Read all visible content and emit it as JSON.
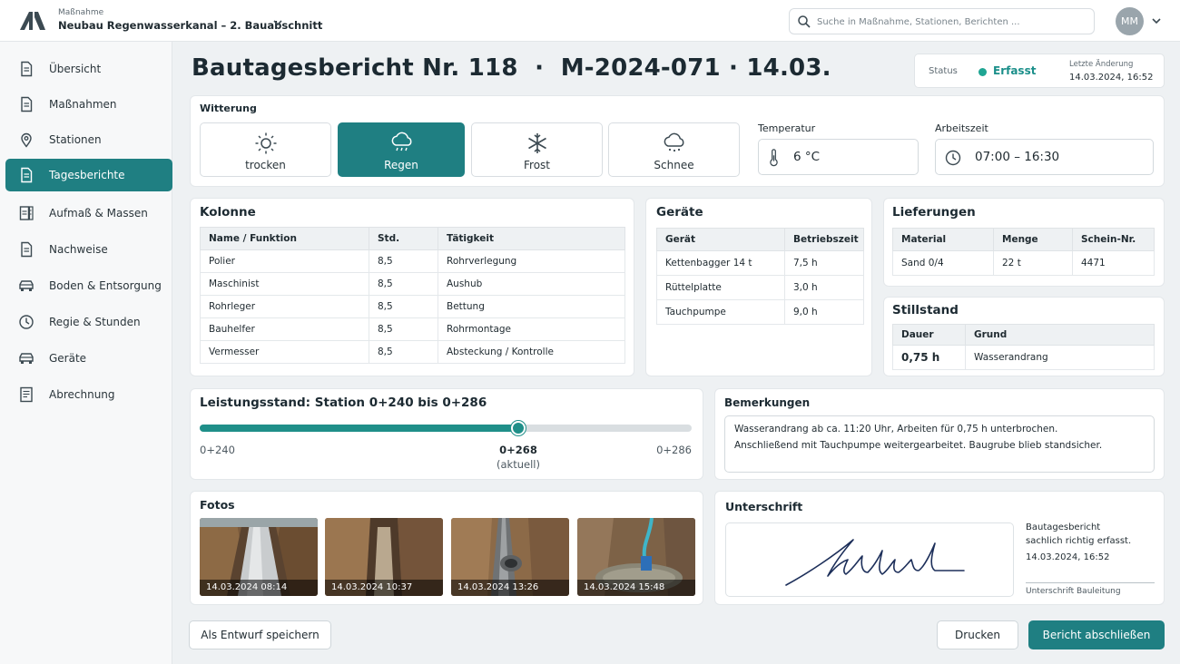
{
  "header": {
    "project_label": "Maßnahme",
    "project_name": "Neubau Regenwasserkanal – 2. Bauabschnitt",
    "search_placeholder": "Suche in Maßnahme, Stationen, Berichten ...",
    "user_initials": "MM"
  },
  "sidebar": {
    "items": [
      {
        "label": "Übersicht",
        "icon": "document-icon"
      },
      {
        "label": "Maßnahmen",
        "icon": "document-icon"
      },
      {
        "label": "Stationen",
        "icon": "location-pin-icon"
      },
      {
        "label": "Tagesberichte",
        "icon": "document-icon",
        "active": true
      },
      {
        "label": "Aufmaß & Massen",
        "icon": "ruler-document-icon"
      },
      {
        "label": "Nachweise",
        "icon": "document-icon"
      },
      {
        "label": "Boden & Entsorgung",
        "icon": "truck-icon"
      },
      {
        "label": "Regie & Stunden",
        "icon": "clock-icon"
      },
      {
        "label": "Geräte",
        "icon": "vehicle-icon"
      },
      {
        "label": "Abrechnung",
        "icon": "invoice-icon"
      }
    ]
  },
  "page": {
    "title": "Bautagesbericht Nr. 118  ·  M-2024-071 · 14.03.",
    "status_label": "Status",
    "status_value": "Erfasst",
    "last_change_label": "Letzte Änderung",
    "last_change_value": "14.03.2024, 16:52"
  },
  "weather": {
    "title": "Witterung",
    "options": [
      {
        "label": "trocken",
        "icon": "sun-icon",
        "selected": false
      },
      {
        "label": "Regen",
        "icon": "rain-cloud-icon",
        "selected": true
      },
      {
        "label": "Frost",
        "icon": "snowflake-icon",
        "selected": false
      },
      {
        "label": "Schnee",
        "icon": "snow-cloud-icon",
        "selected": false
      }
    ],
    "temperature_label": "Temperatur",
    "temperature_value": "6 °C",
    "worktime_label": "Arbeitszeit",
    "worktime_value": "07:00 – 16:30"
  },
  "crew": {
    "title": "Kolonne",
    "headers": [
      "Name / Funktion",
      "Std.",
      "Tätigkeit"
    ],
    "rows": [
      [
        "Polier",
        "8,5",
        "Rohrverlegung"
      ],
      [
        "Maschinist",
        "8,5",
        "Aushub"
      ],
      [
        "Rohrleger",
        "8,5",
        "Bettung"
      ],
      [
        "Bauhelfer",
        "8,5",
        "Rohrmontage"
      ],
      [
        "Vermesser",
        "8,5",
        "Absteckung / Kontrolle"
      ]
    ]
  },
  "equipment": {
    "title": "Geräte",
    "headers": [
      "Gerät",
      "Betriebszeit"
    ],
    "rows": [
      [
        "Kettenbagger 14 t",
        "7,5 h"
      ],
      [
        "Rüttelplatte",
        "3,0 h"
      ],
      [
        "Tauchpumpe",
        "9,0 h"
      ]
    ]
  },
  "deliveries": {
    "title": "Lieferungen",
    "headers": [
      "Material",
      "Menge",
      "Schein-Nr."
    ],
    "rows": [
      [
        "Sand 0/4",
        "22 t",
        "4471"
      ]
    ]
  },
  "downtime": {
    "title": "Stillstand",
    "headers": [
      "Dauer",
      "Grund"
    ],
    "rows": [
      [
        "0,75 h",
        "Wasserandrang"
      ]
    ]
  },
  "progress": {
    "title": "Leistungsstand: Station 0+240 bis 0+286",
    "start_label": "0+240",
    "current_label": "0+268",
    "current_note": "(aktuell)",
    "end_label": "0+286",
    "fraction": 0.648
  },
  "remarks": {
    "title": "Bemerkungen",
    "line1": "Wasserandrang ab ca. 11:20 Uhr, Arbeiten für 0,75 h unterbrochen.",
    "line2": "Anschließend mit Tauchpumpe weitergearbeitet. Baugrube blieb standsicher."
  },
  "photos": {
    "title": "Fotos",
    "items": [
      {
        "timestamp": "14.03.2024 08:14"
      },
      {
        "timestamp": "14.03.2024 10:37"
      },
      {
        "timestamp": "14.03.2024 13:26"
      },
      {
        "timestamp": "14.03.2024 15:48"
      }
    ]
  },
  "signature": {
    "title": "Unterschrift",
    "note_line1": "Bautagesbericht",
    "note_line2": "sachlich richtig erfasst.",
    "note_date": "14.03.2024, 16:52",
    "caption": "Unterschrift Bauleitung"
  },
  "actions": {
    "draft": "Als Entwurf speichern",
    "print": "Drucken",
    "finish": "Bericht abschließen"
  },
  "colors": {
    "accent": "#1f7f82",
    "status": "#1fa593"
  }
}
